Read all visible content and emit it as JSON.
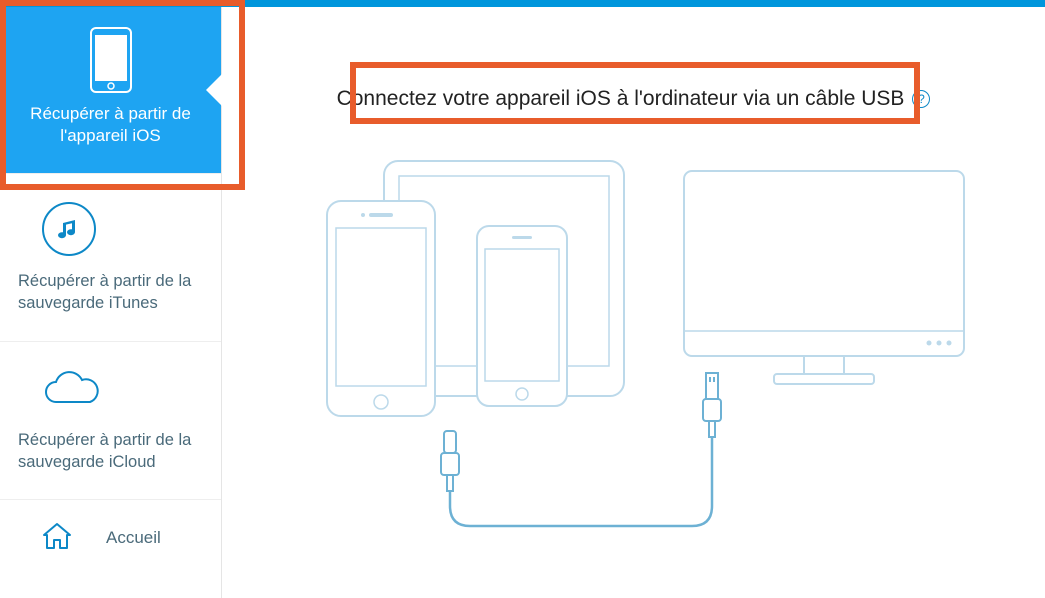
{
  "sidebar": {
    "items": [
      {
        "label": "Récupérer à partir de l'appareil iOS"
      },
      {
        "label": "Récupérer à partir de la sauvegarde iTunes"
      },
      {
        "label": "Récupérer à partir de la sauvegarde iCloud"
      },
      {
        "label": "Accueil"
      }
    ]
  },
  "main": {
    "instruction": "Connectez votre appareil iOS à l'ordinateur via un câble USB",
    "help": "?"
  }
}
